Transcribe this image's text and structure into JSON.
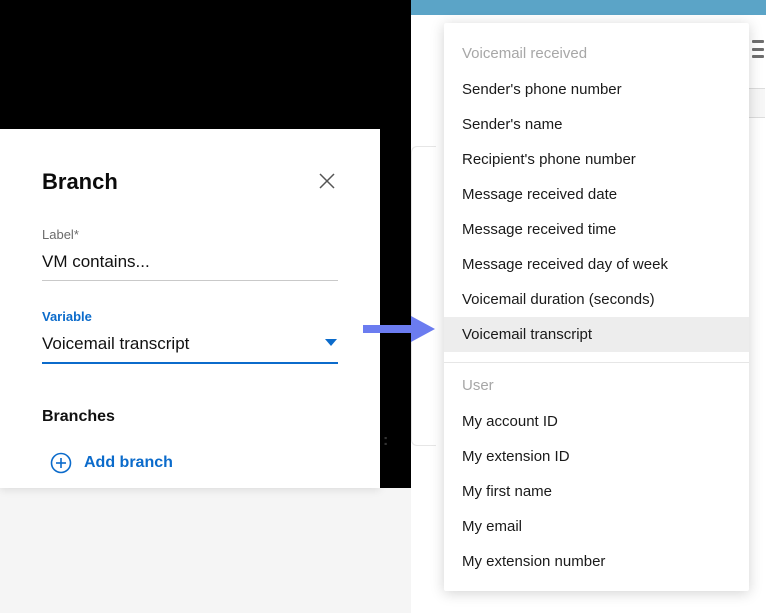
{
  "panel": {
    "title": "Branch",
    "label_field_label": "Label",
    "label_required": "*",
    "label_value": "VM contains...",
    "variable_label": "Variable",
    "variable_value": "Voicemail transcript",
    "branches_heading": "Branches",
    "add_branch_label": "Add branch"
  },
  "dropdown": {
    "groups": [
      {
        "header": "Voicemail received",
        "items": [
          {
            "label": "Sender's phone number",
            "selected": false
          },
          {
            "label": "Sender's name",
            "selected": false
          },
          {
            "label": "Recipient's phone number",
            "selected": false
          },
          {
            "label": "Message received date",
            "selected": false
          },
          {
            "label": "Message received time",
            "selected": false
          },
          {
            "label": "Message received day of week",
            "selected": false
          },
          {
            "label": "Voicemail duration (seconds)",
            "selected": false
          },
          {
            "label": "Voicemail transcript",
            "selected": true
          }
        ]
      },
      {
        "header": "User",
        "items": [
          {
            "label": "My account ID",
            "selected": false
          },
          {
            "label": "My extension ID",
            "selected": false
          },
          {
            "label": "My first name",
            "selected": false
          },
          {
            "label": "My email",
            "selected": false
          },
          {
            "label": "My extension number",
            "selected": false
          }
        ]
      }
    ]
  },
  "colors": {
    "accent": "#0b6bcb",
    "arrow": "#6b7cf0"
  }
}
